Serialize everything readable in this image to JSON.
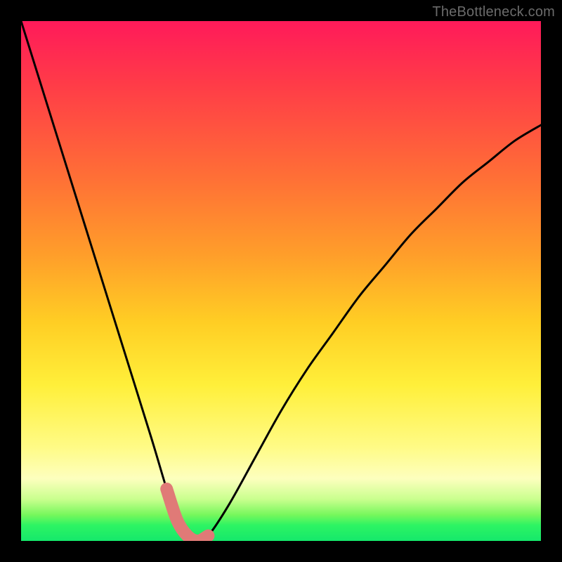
{
  "watermark": "TheBottleneck.com",
  "chart_data": {
    "type": "line",
    "title": "",
    "xlabel": "",
    "ylabel": "",
    "xlim": [
      0,
      100
    ],
    "ylim": [
      0,
      100
    ],
    "series": [
      {
        "name": "bottleneck-curve",
        "x": [
          0,
          5,
          10,
          15,
          20,
          25,
          28,
          30,
          32,
          34,
          36,
          40,
          45,
          50,
          55,
          60,
          65,
          70,
          75,
          80,
          85,
          90,
          95,
          100
        ],
        "values": [
          100,
          84,
          68,
          52,
          36,
          20,
          10,
          4,
          1,
          0,
          1,
          7,
          16,
          25,
          33,
          40,
          47,
          53,
          59,
          64,
          69,
          73,
          77,
          80
        ]
      }
    ],
    "highlight_zone": {
      "name": "valley-marker",
      "color": "#e07a77",
      "points_index": [
        6,
        7,
        8,
        9,
        10
      ]
    },
    "background_gradient": {
      "top_color": "#ff1a5a",
      "mid_color": "#ffef3a",
      "bottom_color": "#15e86b"
    }
  }
}
